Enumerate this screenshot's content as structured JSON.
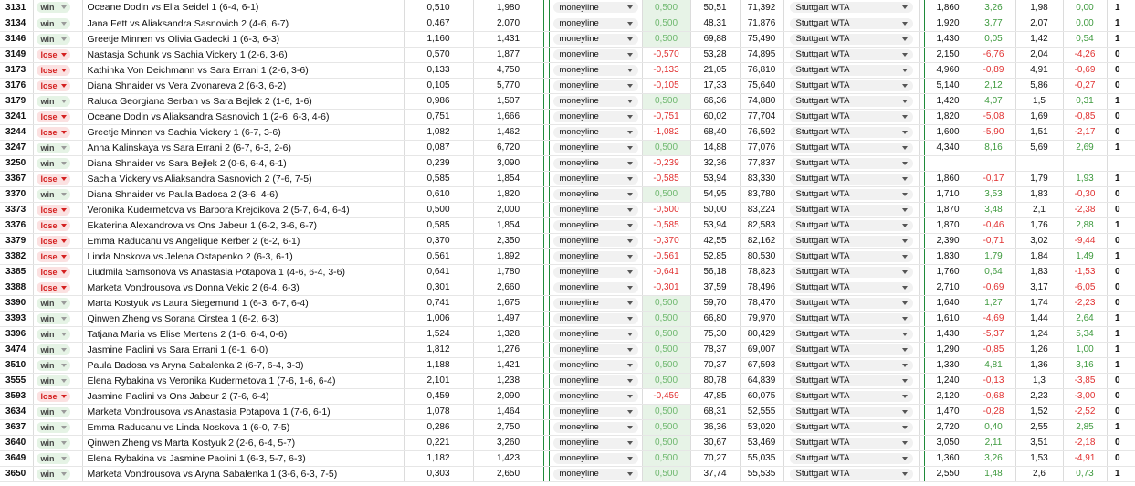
{
  "ui": {
    "bet_type": "moneyline",
    "bookmaker": "Stuttgart WTA"
  },
  "rows": [
    {
      "id": "3131",
      "result": "win",
      "match": "Oceane Dodin vs Ella Seidel 1 (6-4, 6-1)",
      "prob": "0,510",
      "odds": "1,980",
      "pl": "0,500",
      "o1": "50,51",
      "o2": "71,392",
      "closing": "1,860",
      "clv": "3,26",
      "close2": "1,98",
      "pl2": "0,00",
      "res": "1"
    },
    {
      "id": "3134",
      "result": "win",
      "match": "Jana Fett vs Aliaksandra Sasnovich 2 (4-6, 6-7)",
      "prob": "0,467",
      "odds": "2,070",
      "pl": "0,500",
      "o1": "48,31",
      "o2": "71,876",
      "closing": "1,920",
      "clv": "3,77",
      "close2": "2,07",
      "pl2": "0,00",
      "res": "1"
    },
    {
      "id": "3146",
      "result": "win",
      "match": "Greetje Minnen vs Olivia Gadecki 1 (6-3, 6-3)",
      "prob": "1,160",
      "odds": "1,431",
      "pl": "0,500",
      "o1": "69,88",
      "o2": "75,490",
      "closing": "1,430",
      "clv": "0,05",
      "close2": "1,42",
      "pl2": "0,54",
      "res": "1"
    },
    {
      "id": "3149",
      "result": "lose",
      "match": "Nastasja Schunk vs Sachia Vickery 1 (2-6, 3-6)",
      "prob": "0,570",
      "odds": "1,877",
      "pl": "-0,570",
      "o1": "53,28",
      "o2": "74,895",
      "closing": "2,150",
      "clv": "-6,76",
      "close2": "2,04",
      "pl2": "-4,26",
      "res": "0"
    },
    {
      "id": "3173",
      "result": "lose",
      "match": "Kathinka Von Deichmann vs Sara Errani 1 (2-6, 3-6)",
      "prob": "0,133",
      "odds": "4,750",
      "pl": "-0,133",
      "o1": "21,05",
      "o2": "76,810",
      "closing": "4,960",
      "clv": "-0,89",
      "close2": "4,91",
      "pl2": "-0,69",
      "res": "0"
    },
    {
      "id": "3176",
      "result": "lose",
      "match": "Diana Shnaider vs Vera Zvonareva 2 (6-3, 6-2)",
      "prob": "0,105",
      "odds": "5,770",
      "pl": "-0,105",
      "o1": "17,33",
      "o2": "75,640",
      "closing": "5,140",
      "clv": "2,12",
      "close2": "5,86",
      "pl2": "-0,27",
      "res": "0"
    },
    {
      "id": "3179",
      "result": "win",
      "match": "Raluca Georgiana Serban vs Sara Bejlek 2 (1-6, 1-6)",
      "prob": "0,986",
      "odds": "1,507",
      "pl": "0,500",
      "o1": "66,36",
      "o2": "74,880",
      "closing": "1,420",
      "clv": "4,07",
      "close2": "1,5",
      "pl2": "0,31",
      "res": "1"
    },
    {
      "id": "3241",
      "result": "lose",
      "match": "Oceane Dodin vs Aliaksandra Sasnovich 1 (2-6, 6-3, 4-6)",
      "prob": "0,751",
      "odds": "1,666",
      "pl": "-0,751",
      "o1": "60,02",
      "o2": "77,704",
      "closing": "1,820",
      "clv": "-5,08",
      "close2": "1,69",
      "pl2": "-0,85",
      "res": "0"
    },
    {
      "id": "3244",
      "result": "lose",
      "match": "Greetje Minnen vs Sachia Vickery 1 (6-7, 3-6)",
      "prob": "1,082",
      "odds": "1,462",
      "pl": "-1,082",
      "o1": "68,40",
      "o2": "76,592",
      "closing": "1,600",
      "clv": "-5,90",
      "close2": "1,51",
      "pl2": "-2,17",
      "res": "0"
    },
    {
      "id": "3247",
      "result": "win",
      "match": "Anna Kalinskaya vs Sara Errani 2 (6-7, 6-3, 2-6)",
      "prob": "0,087",
      "odds": "6,720",
      "pl": "0,500",
      "o1": "14,88",
      "o2": "77,076",
      "closing": "4,340",
      "clv": "8,16",
      "close2": "5,69",
      "pl2": "2,69",
      "res": "1"
    },
    {
      "id": "3250",
      "result": "win",
      "match": "Diana Shnaider vs Sara Bejlek 2 (0-6, 6-4, 6-1)",
      "prob": "0,239",
      "odds": "3,090",
      "pl": "-0,239",
      "o1": "32,36",
      "o2": "77,837",
      "closing": "",
      "clv": "",
      "close2": "",
      "pl2": "",
      "res": ""
    },
    {
      "id": "3367",
      "result": "lose",
      "match": "Sachia Vickery vs Aliaksandra Sasnovich 2 (7-6, 7-5)",
      "prob": "0,585",
      "odds": "1,854",
      "pl": "-0,585",
      "o1": "53,94",
      "o2": "83,330",
      "closing": "1,860",
      "clv": "-0,17",
      "close2": "1,79",
      "pl2": "1,93",
      "res": "1"
    },
    {
      "id": "3370",
      "result": "win",
      "match": "Diana Shnaider vs Paula Badosa 2 (3-6, 4-6)",
      "prob": "0,610",
      "odds": "1,820",
      "pl": "0,500",
      "o1": "54,95",
      "o2": "83,780",
      "closing": "1,710",
      "clv": "3,53",
      "close2": "1,83",
      "pl2": "-0,30",
      "res": "0"
    },
    {
      "id": "3373",
      "result": "lose",
      "match": "Veronika Kudermetova vs Barbora Krejcikova 2 (5-7, 6-4, 6-4)",
      "prob": "0,500",
      "odds": "2,000",
      "pl": "-0,500",
      "o1": "50,00",
      "o2": "83,224",
      "closing": "1,870",
      "clv": "3,48",
      "close2": "2,1",
      "pl2": "-2,38",
      "res": "0"
    },
    {
      "id": "3376",
      "result": "lose",
      "match": "Ekaterina Alexandrova vs Ons Jabeur 1 (6-2, 3-6, 6-7)",
      "prob": "0,585",
      "odds": "1,854",
      "pl": "-0,585",
      "o1": "53,94",
      "o2": "82,583",
      "closing": "1,870",
      "clv": "-0,46",
      "close2": "1,76",
      "pl2": "2,88",
      "res": "1"
    },
    {
      "id": "3379",
      "result": "lose",
      "match": "Emma Raducanu vs Angelique Kerber 2 (6-2, 6-1)",
      "prob": "0,370",
      "odds": "2,350",
      "pl": "-0,370",
      "o1": "42,55",
      "o2": "82,162",
      "closing": "2,390",
      "clv": "-0,71",
      "close2": "3,02",
      "pl2": "-9,44",
      "res": "0"
    },
    {
      "id": "3382",
      "result": "lose",
      "match": "Linda Noskova vs Jelena Ostapenko 2 (6-3, 6-1)",
      "prob": "0,561",
      "odds": "1,892",
      "pl": "-0,561",
      "o1": "52,85",
      "o2": "80,530",
      "closing": "1,830",
      "clv": "1,79",
      "close2": "1,84",
      "pl2": "1,49",
      "res": "1"
    },
    {
      "id": "3385",
      "result": "lose",
      "match": "Liudmila Samsonova vs Anastasia Potapova 1 (4-6, 6-4, 3-6)",
      "prob": "0,641",
      "odds": "1,780",
      "pl": "-0,641",
      "o1": "56,18",
      "o2": "78,823",
      "closing": "1,760",
      "clv": "0,64",
      "close2": "1,83",
      "pl2": "-1,53",
      "res": "0"
    },
    {
      "id": "3388",
      "result": "lose",
      "match": "Marketa Vondrousova vs Donna Vekic 2 (6-4, 6-3)",
      "prob": "0,301",
      "odds": "2,660",
      "pl": "-0,301",
      "o1": "37,59",
      "o2": "78,496",
      "closing": "2,710",
      "clv": "-0,69",
      "close2": "3,17",
      "pl2": "-6,05",
      "res": "0"
    },
    {
      "id": "3390",
      "result": "win",
      "match": "Marta Kostyuk vs Laura Siegemund 1 (6-3, 6-7, 6-4)",
      "prob": "0,741",
      "odds": "1,675",
      "pl": "0,500",
      "o1": "59,70",
      "o2": "78,470",
      "closing": "1,640",
      "clv": "1,27",
      "close2": "1,74",
      "pl2": "-2,23",
      "res": "0"
    },
    {
      "id": "3393",
      "result": "win",
      "match": "Qinwen Zheng vs Sorana Cirstea 1 (6-2, 6-3)",
      "prob": "1,006",
      "odds": "1,497",
      "pl": "0,500",
      "o1": "66,80",
      "o2": "79,970",
      "closing": "1,610",
      "clv": "-4,69",
      "close2": "1,44",
      "pl2": "2,64",
      "res": "1"
    },
    {
      "id": "3396",
      "result": "win",
      "match": "Tatjana Maria vs Elise Mertens 2 (1-6, 6-4, 0-6)",
      "prob": "1,524",
      "odds": "1,328",
      "pl": "0,500",
      "o1": "75,30",
      "o2": "80,429",
      "closing": "1,430",
      "clv": "-5,37",
      "close2": "1,24",
      "pl2": "5,34",
      "res": "1"
    },
    {
      "id": "3474",
      "result": "win",
      "match": "Jasmine Paolini vs Sara Errani 1 (6-1, 6-0)",
      "prob": "1,812",
      "odds": "1,276",
      "pl": "0,500",
      "o1": "78,37",
      "o2": "69,007",
      "closing": "1,290",
      "clv": "-0,85",
      "close2": "1,26",
      "pl2": "1,00",
      "res": "1"
    },
    {
      "id": "3510",
      "result": "win",
      "match": "Paula Badosa vs Aryna Sabalenka 2 (6-7, 6-4, 3-3)",
      "prob": "1,188",
      "odds": "1,421",
      "pl": "0,500",
      "o1": "70,37",
      "o2": "67,593",
      "closing": "1,330",
      "clv": "4,81",
      "close2": "1,36",
      "pl2": "3,16",
      "res": "1"
    },
    {
      "id": "3555",
      "result": "win",
      "match": "Elena Rybakina vs Veronika Kudermetova 1 (7-6, 1-6, 6-4)",
      "prob": "2,101",
      "odds": "1,238",
      "pl": "0,500",
      "o1": "80,78",
      "o2": "64,839",
      "closing": "1,240",
      "clv": "-0,13",
      "close2": "1,3",
      "pl2": "-3,85",
      "res": "0"
    },
    {
      "id": "3593",
      "result": "lose",
      "match": "Jasmine Paolini vs Ons Jabeur 2 (7-6, 6-4)",
      "prob": "0,459",
      "odds": "2,090",
      "pl": "-0,459",
      "o1": "47,85",
      "o2": "60,075",
      "closing": "2,120",
      "clv": "-0,68",
      "close2": "2,23",
      "pl2": "-3,00",
      "res": "0"
    },
    {
      "id": "3634",
      "result": "win",
      "match": "Marketa Vondrousova vs Anastasia Potapova 1 (7-6, 6-1)",
      "prob": "1,078",
      "odds": "1,464",
      "pl": "0,500",
      "o1": "68,31",
      "o2": "52,555",
      "closing": "1,470",
      "clv": "-0,28",
      "close2": "1,52",
      "pl2": "-2,52",
      "res": "0"
    },
    {
      "id": "3637",
      "result": "win",
      "match": "Emma Raducanu vs Linda Noskova 1 (6-0, 7-5)",
      "prob": "0,286",
      "odds": "2,750",
      "pl": "0,500",
      "o1": "36,36",
      "o2": "53,020",
      "closing": "2,720",
      "clv": "0,40",
      "close2": "2,55",
      "pl2": "2,85",
      "res": "1"
    },
    {
      "id": "3640",
      "result": "win",
      "match": "Qinwen Zheng vs Marta Kostyuk 2 (2-6, 6-4, 5-7)",
      "prob": "0,221",
      "odds": "3,260",
      "pl": "0,500",
      "o1": "30,67",
      "o2": "53,469",
      "closing": "3,050",
      "clv": "2,11",
      "close2": "3,51",
      "pl2": "-2,18",
      "res": "0"
    },
    {
      "id": "3649",
      "result": "win",
      "match": "Elena Rybakina vs Jasmine Paolini 1 (6-3, 5-7, 6-3)",
      "prob": "1,182",
      "odds": "1,423",
      "pl": "0,500",
      "o1": "70,27",
      "o2": "55,035",
      "closing": "1,360",
      "clv": "3,26",
      "close2": "1,53",
      "pl2": "-4,91",
      "res": "0"
    },
    {
      "id": "3650",
      "result": "win",
      "match": "Marketa Vondrousova vs Aryna Sabalenka 1 (3-6, 6-3, 7-5)",
      "prob": "0,303",
      "odds": "2,650",
      "pl": "0,500",
      "o1": "37,74",
      "o2": "55,535",
      "closing": "2,550",
      "clv": "1,48",
      "close2": "2,6",
      "pl2": "0,73",
      "res": "1"
    }
  ]
}
